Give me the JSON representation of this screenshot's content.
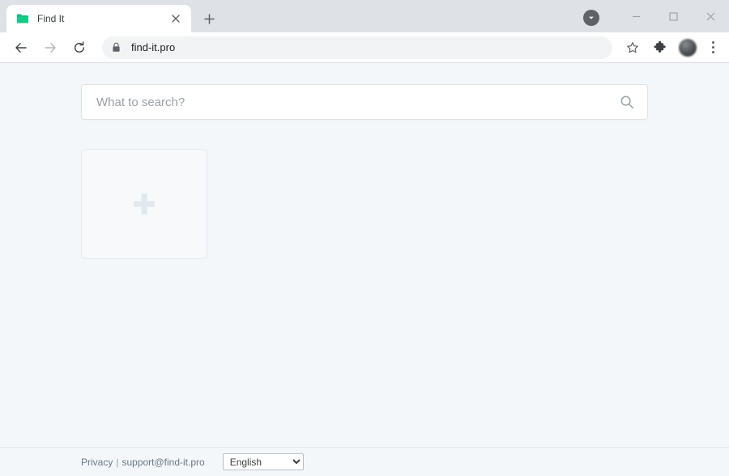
{
  "browser": {
    "tab": {
      "title": "Find It",
      "favicon_name": "folder-icon",
      "favicon_color": "#0fbe7c",
      "close_label": "×"
    },
    "new_tab_label": "+",
    "download_indicator": "download-chevron",
    "window_controls": {
      "minimize": "minimize",
      "maximize": "maximize",
      "close": "close"
    },
    "nav": {
      "back": "back-arrow",
      "forward": "forward-arrow",
      "reload": "reload-arrow"
    },
    "omnibox": {
      "lock": "padlock-icon",
      "url": "find-it.pro"
    },
    "actions": {
      "bookmark": "star-icon",
      "extensions": "puzzle-piece-icon",
      "profile": "avatar",
      "menu": "three-dot-menu"
    }
  },
  "page": {
    "search": {
      "placeholder": "What to search?",
      "value": "",
      "submit_icon": "search-icon"
    },
    "tiles": [
      {
        "type": "add",
        "icon": "plus-icon",
        "label": ""
      }
    ],
    "footer": {
      "privacy_label": "Privacy",
      "separator": "|",
      "support_label": "support@find-it.pro",
      "language": {
        "selected": "English",
        "options": [
          "English"
        ]
      }
    }
  },
  "colors": {
    "page_background": "#f4f7fa",
    "tabstrip": "#dee1e6",
    "accent_green": "#0fbe7c",
    "text_muted": "#9aa0a6"
  }
}
